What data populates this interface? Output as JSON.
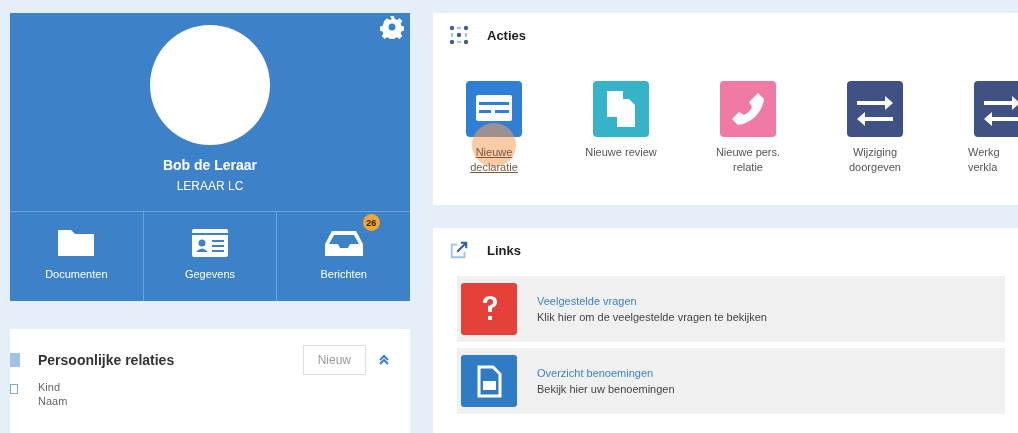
{
  "profile": {
    "name": "Bob de Leraar",
    "role": "LERAAR LC"
  },
  "tiles": [
    {
      "kind": "folder",
      "label": "Documenten"
    },
    {
      "kind": "card",
      "label": "Gegevens"
    },
    {
      "kind": "inbox",
      "label": "Berichten",
      "badge": "26"
    }
  ],
  "relations": {
    "title": "Persoonlijke relaties",
    "button": "Nieuw",
    "lines": [
      "Kind",
      "Naam"
    ]
  },
  "actions": {
    "title": "Acties",
    "items": [
      {
        "kind": "declaration",
        "color": "#2f7fd6",
        "lines": [
          "Nieuwe",
          "declaratie"
        ],
        "highlighted": true
      },
      {
        "kind": "copy",
        "color": "#37b3c9",
        "lines": [
          "Nieuwe review"
        ],
        "highlighted": false
      },
      {
        "kind": "phone",
        "color": "#f07aa6",
        "lines": [
          "Nieuwe pers.",
          "relatie"
        ],
        "highlighted": false
      },
      {
        "kind": "swap",
        "color": "#3f5283",
        "lines": [
          "Wijziging",
          "doorgeven"
        ],
        "highlighted": false
      },
      {
        "kind": "swap",
        "color": "#3f5283",
        "lines": [
          "Werkg",
          "verkla"
        ],
        "highlighted": false
      }
    ]
  },
  "links": {
    "title": "Links",
    "items": [
      {
        "kind": "question",
        "color": "#e5403a",
        "title": "Veelgestelde vragen",
        "text": "Klik hier om de veelgestelde vragen te bekijken"
      },
      {
        "kind": "document",
        "color": "#2f7bc4",
        "title": "Overzicht benoemingen",
        "text": "Bekijk hier uw benoemingen"
      }
    ]
  }
}
